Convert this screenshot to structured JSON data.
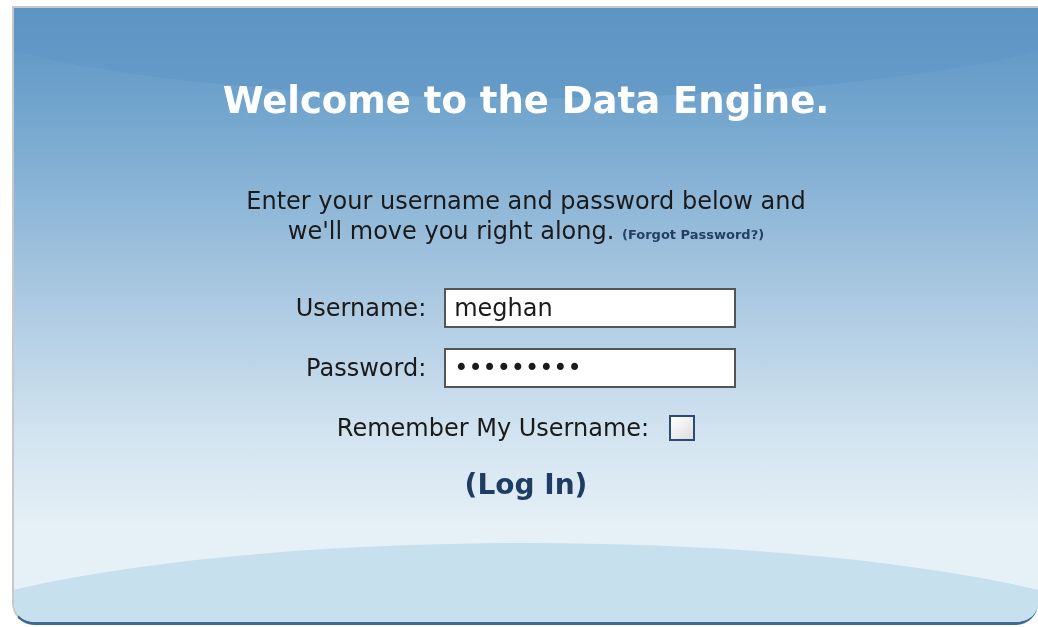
{
  "heading": "Welcome to the Data Engine.",
  "intro": "Enter your username and password below and we'll move you right along.",
  "forgot_link": "(Forgot Password?)",
  "fields": [
    {
      "label": "Username:",
      "value": "meghan"
    },
    {
      "label": "Password:",
      "value": "•••••••••"
    }
  ],
  "remember": {
    "label": "Remember My Username:",
    "checked": false
  },
  "login_button": "(Log In)"
}
